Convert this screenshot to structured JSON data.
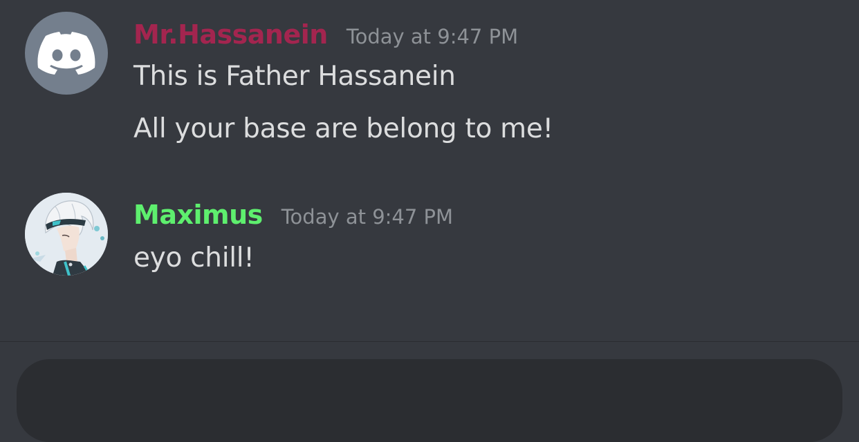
{
  "messages": [
    {
      "author": "Mr.Hassanein",
      "author_color": "#a3254f",
      "timestamp": "Today at 9:47 PM",
      "avatar": "discord-default-avatar-icon",
      "lines": [
        "This is Father Hassanein",
        "All your base are belong to me!"
      ]
    },
    {
      "author": "Maximus",
      "author_color": "#5eef6e",
      "timestamp": "Today at 9:47 PM",
      "avatar": "anime-character-avatar",
      "lines": [
        "eyo chill!"
      ]
    }
  ],
  "colors": {
    "background": "#36393f",
    "text": "#dcddde",
    "timestamp": "#8e9297",
    "composer": "#2b2d31"
  }
}
